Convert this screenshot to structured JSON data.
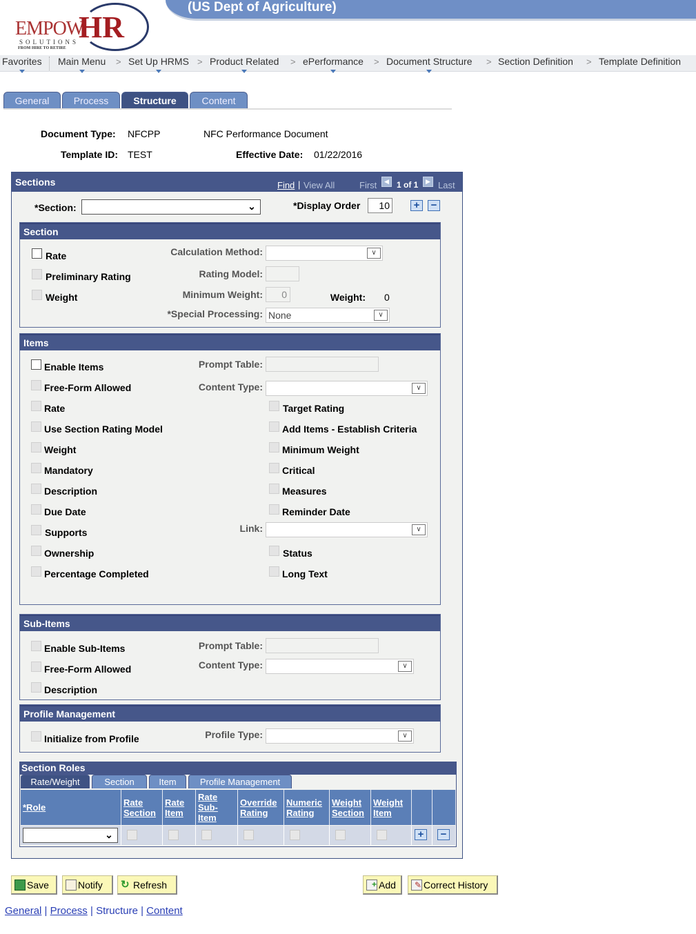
{
  "header": {
    "org_title": "(US Dept of Agriculture)",
    "logo": {
      "brand_left": "EMPOW",
      "brand_right": "HR",
      "sub": "SOLUTIONS",
      "tagline": "FROM HIRE TO RETIRE"
    }
  },
  "breadcrumb": [
    {
      "label": "Favorites",
      "menu": true
    },
    {
      "label": "Main Menu",
      "menu": true
    },
    {
      "label": "Set Up HRMS",
      "menu": true
    },
    {
      "label": "Product Related",
      "menu": true
    },
    {
      "label": "ePerformance",
      "menu": true
    },
    {
      "label": "Document Structure",
      "menu": true
    },
    {
      "label": "Section Definition",
      "menu": false
    },
    {
      "label": "Template Definition",
      "menu": false
    }
  ],
  "breadcrumb_separator": ">",
  "page_tabs": [
    {
      "label": "General",
      "active": false
    },
    {
      "label": "Process",
      "active": false
    },
    {
      "label": "Structure",
      "active": true
    },
    {
      "label": "Content",
      "active": false
    }
  ],
  "info": {
    "document_type_label": "Document Type:",
    "document_type_value": "NFCPP",
    "document_type_desc": "NFC Performance Document",
    "template_id_label": "Template ID:",
    "template_id_value": "TEST",
    "effective_date_label": "Effective Date:",
    "effective_date_value": "01/22/2016"
  },
  "sections": {
    "title": "Sections",
    "find": "Find",
    "view_all": "View All",
    "first": "First",
    "count": "1 of 1",
    "last": "Last",
    "section_label": "*Section:",
    "section_value": "",
    "display_order_label": "*Display Order",
    "display_order_value": "10",
    "add": "+",
    "remove": "−"
  },
  "section_group": {
    "title": "Section",
    "rate": "Rate",
    "preliminary_rating": "Preliminary Rating",
    "weight": "Weight",
    "calculation_method_label": "Calculation Method:",
    "calculation_method_value": "",
    "rating_model_label": "Rating Model:",
    "rating_model_value": "",
    "minimum_weight_label": "Minimum Weight:",
    "minimum_weight_value": "0",
    "weight_label": "Weight:",
    "weight_value": "0",
    "special_processing_label": "*Special Processing:",
    "special_processing_value": "None"
  },
  "items_group": {
    "title": "Items",
    "prompt_table_label": "Prompt Table:",
    "prompt_table_value": "",
    "content_type_label": "Content Type:",
    "content_type_value": "",
    "link_label": "Link:",
    "link_value": "",
    "left": [
      "Enable Items",
      "Free-Form Allowed",
      "Rate",
      "Use Section Rating Model",
      "Weight",
      "Mandatory",
      "Description",
      "Due Date",
      "Supports",
      "Ownership",
      "Percentage Completed"
    ],
    "right": [
      "Target Rating",
      "Add Items - Establish Criteria",
      "Minimum Weight",
      "Critical",
      "Measures",
      "Reminder Date",
      "Status",
      "Long Text"
    ]
  },
  "subitems_group": {
    "title": "Sub-Items",
    "enable": "Enable Sub-Items",
    "free_form": "Free-Form Allowed",
    "description": "Description",
    "prompt_table_label": "Prompt Table:",
    "prompt_table_value": "",
    "content_type_label": "Content Type:",
    "content_type_value": ""
  },
  "profile_group": {
    "title": "Profile Management",
    "initialize": "Initialize from Profile",
    "profile_type_label": "Profile Type:",
    "profile_type_value": ""
  },
  "roles": {
    "title": "Section Roles",
    "tabs": [
      {
        "label": "Rate/Weight",
        "active": true
      },
      {
        "label": "Section",
        "active": false
      },
      {
        "label": "Item",
        "active": false
      },
      {
        "label": "Profile Management",
        "active": false
      }
    ],
    "columns": [
      {
        "lines": [
          "*Role"
        ]
      },
      {
        "lines": [
          "Rate",
          "Section"
        ]
      },
      {
        "lines": [
          "Rate",
          "Item"
        ]
      },
      {
        "lines": [
          "Rate",
          "Sub-",
          "Item"
        ]
      },
      {
        "lines": [
          "Override",
          "Rating"
        ]
      },
      {
        "lines": [
          "Numeric",
          "Rating"
        ]
      },
      {
        "lines": [
          "Weight",
          "Section"
        ]
      },
      {
        "lines": [
          "Weight",
          "Item"
        ]
      }
    ],
    "row": {
      "role_value": "",
      "checks": [
        false,
        false,
        false,
        false,
        false,
        false,
        false
      ]
    },
    "add": "+",
    "remove": "−"
  },
  "buttons": {
    "save": "Save",
    "notify": "Notify",
    "refresh": "Refresh",
    "add": "Add",
    "correct_history": "Correct History"
  },
  "bottom_links": [
    {
      "label": "General",
      "current": false
    },
    {
      "label": "Process",
      "current": false
    },
    {
      "label": "Structure",
      "current": true
    },
    {
      "label": "Content",
      "current": false
    }
  ],
  "colors": {
    "header_blue": "#46578a",
    "tab_blue": "#6e8fc4",
    "banner_blue": "#6f8fc6",
    "button_yellow": "#fbf8b8",
    "link_blue": "#2a3fb5"
  }
}
